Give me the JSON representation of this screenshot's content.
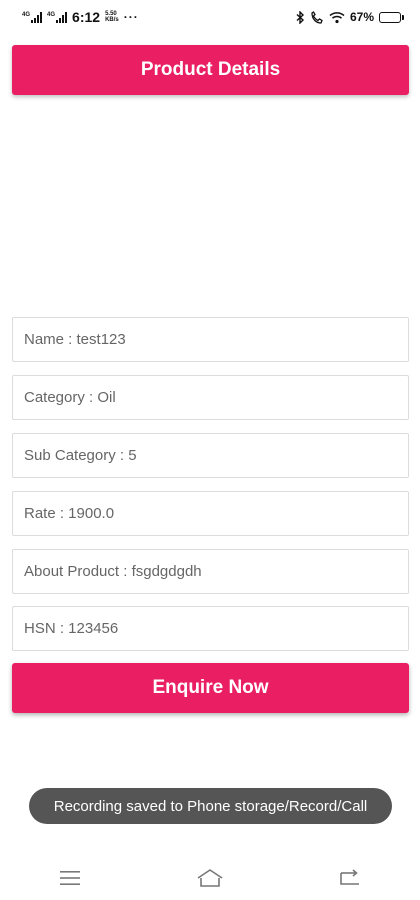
{
  "status_bar": {
    "time": "6:12",
    "network_label_1": "4G",
    "network_label_2": "4G",
    "net_speed_value": "5.50",
    "net_speed_unit": "KB/s",
    "more": "···",
    "battery_percent": "67%",
    "battery_level": 0.67
  },
  "header": {
    "title": "Product Details"
  },
  "fields": [
    {
      "text": "Name : test123"
    },
    {
      "text": "Category : Oil"
    },
    {
      "text": "Sub Category : 5"
    },
    {
      "text": "Rate : 1900.0"
    },
    {
      "text": "About Product : fsgdgdgdh"
    },
    {
      "text": "HSN : 123456"
    }
  ],
  "enquire_button": {
    "label": "Enquire Now"
  },
  "toast": {
    "message": "Recording saved to Phone storage/Record/Call"
  },
  "navbar": {
    "icons": [
      "menu-icon",
      "home-icon",
      "back-icon"
    ]
  },
  "colors": {
    "accent": "#e91e63",
    "toast_bg": "#555555",
    "border": "#dcdcdc"
  }
}
